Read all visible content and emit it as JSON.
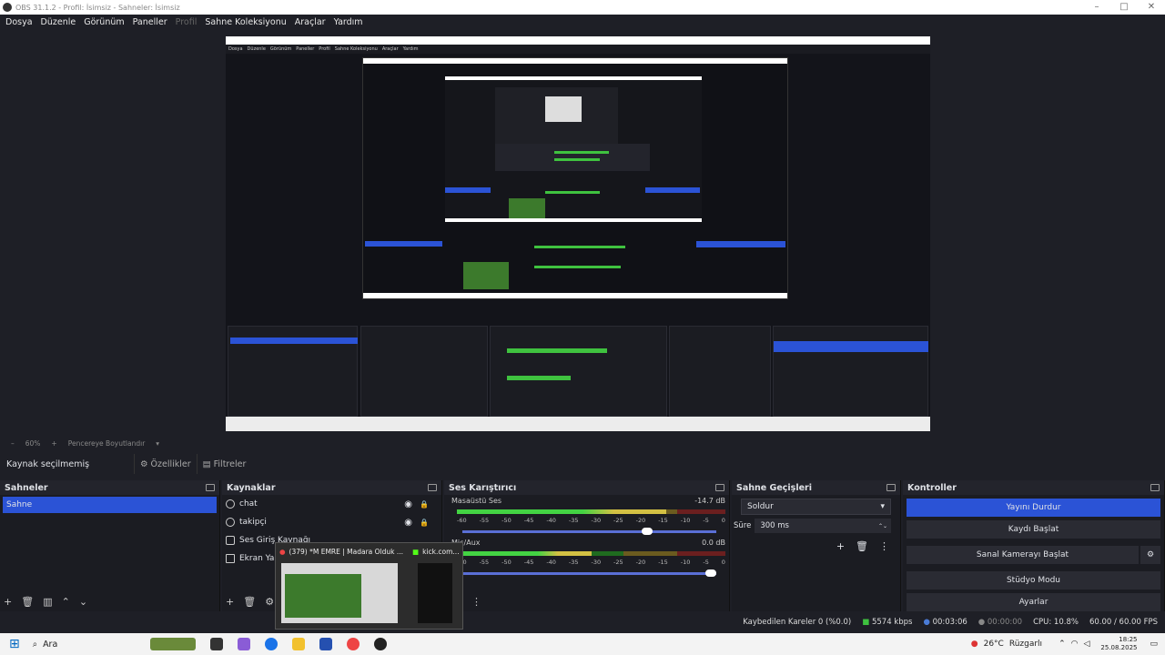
{
  "window": {
    "title": "OBS 31.1.2 - Profil: İsimsiz - Sahneler: İsimsiz"
  },
  "menu": [
    "Dosya",
    "Düzenle",
    "Görünüm",
    "Paneller",
    "Profil",
    "Sahne Koleksiyonu",
    "Araçlar",
    "Yardım"
  ],
  "preview_zoom": {
    "zoom": "60%",
    "fit": "Pencereye Boyutlandır"
  },
  "source_bar": {
    "label": "Kaynak seçilmemiş",
    "properties": "Özellikler",
    "filters": "Filtreler"
  },
  "docks": {
    "scenes": {
      "title": "Sahneler",
      "items": [
        "Sahne"
      ]
    },
    "sources": {
      "title": "Kaynaklar",
      "items": [
        "chat",
        "takipçi",
        "Ses Giriş Kaynağı",
        "Ekran Yakalama"
      ]
    },
    "mixer": {
      "title": "Ses Karıştırıcı",
      "channels": [
        {
          "name": "Masaüstü Ses",
          "db": "-14.7 dB",
          "level": 0.78,
          "volume": 0.75
        },
        {
          "name": "Mic/Aux",
          "db": "0.0 dB",
          "level": 0.5,
          "volume": 1.0
        }
      ],
      "ticks": [
        "-60",
        "-55",
        "-50",
        "-45",
        "-40",
        "-35",
        "-30",
        "-25",
        "-20",
        "-15",
        "-10",
        "-5",
        "0"
      ]
    },
    "transitions": {
      "title": "Sahne Geçişleri",
      "selected": "Soldur",
      "duration_label": "Süre",
      "duration": "300 ms"
    },
    "controls": {
      "title": "Kontroller",
      "buttons": [
        "Yayını Durdur",
        "Kaydı Başlat",
        "Sanal Kamerayı Başlat",
        "Stüdyo Modu",
        "Ayarlar"
      ]
    }
  },
  "status": {
    "dropped": "Kaybedilen Kareler 0 (%0.0)",
    "bitrate": "5574 kbps",
    "stream_time": "00:03:06",
    "rec_time": "00:00:00",
    "cpu": "CPU: 10.8%",
    "fps": "60.00 / 60.00 FPS"
  },
  "taskbar": {
    "search": "Ara",
    "weather": "26°C",
    "weather_text": "Rüzgarlı",
    "time": "18:25",
    "date": "25.08.2025"
  },
  "thumbnail": {
    "tab1": "(379) *M EMRE | Madara Olduk ...",
    "tab2": "kick.com..."
  }
}
